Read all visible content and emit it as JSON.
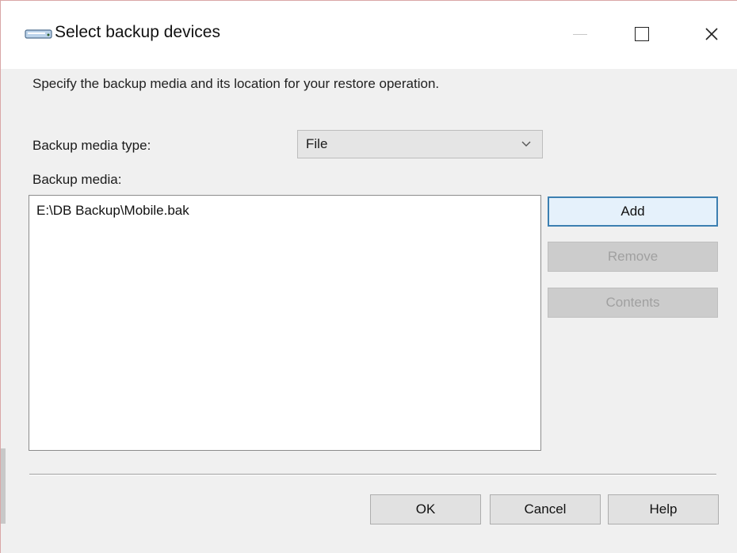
{
  "window": {
    "title": "Select backup devices",
    "icon": "disk-drive-icon"
  },
  "titlebar": {
    "minimize_icon": "minimize-icon",
    "maximize_icon": "maximize-icon",
    "close_icon": "close-icon",
    "close_glyph": "×"
  },
  "dialog": {
    "instructions": "Specify the backup media and its location for your restore operation.",
    "media_type_label": "Backup media type:",
    "media_type_value": "File",
    "media_label": "Backup media:",
    "media_items": [
      "E:\\DB Backup\\Mobile.bak"
    ],
    "buttons": {
      "add": "Add",
      "remove": "Remove",
      "contents": "Contents",
      "ok": "OK",
      "cancel": "Cancel",
      "help": "Help"
    }
  },
  "colors": {
    "accent": "#3c7fb1",
    "dialog_bg": "#f0f0f0",
    "disabled_text": "#a0a0a0"
  }
}
